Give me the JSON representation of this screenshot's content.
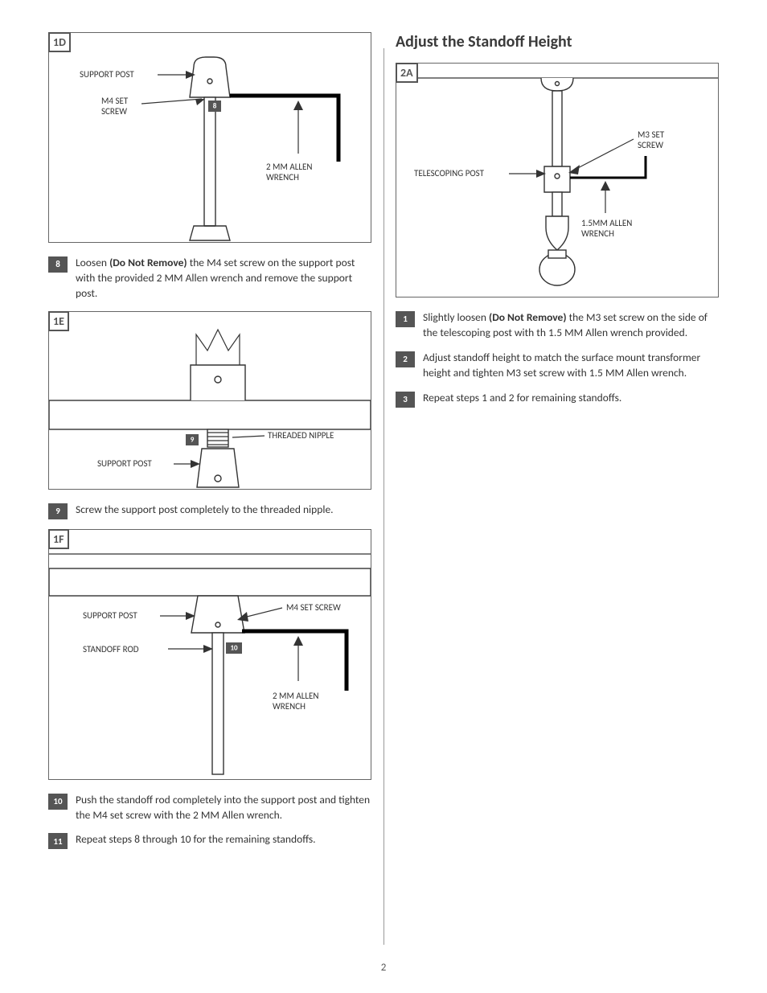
{
  "page_number": "2",
  "section2_title": "Adjust the Standoff Height",
  "figs": {
    "d": {
      "tag": "1D",
      "label_support_post": "SUPPORT POST",
      "label_m4": "M4 SET\nSCREW",
      "label_wrench": "2 MM ALLEN\nWRENCH",
      "callout": "8"
    },
    "e": {
      "tag": "1E",
      "label_nipple": "THREADED NIPPLE",
      "label_support_post": "SUPPORT POST",
      "callout": "9"
    },
    "f": {
      "tag": "1F",
      "label_support_post": "SUPPORT POST",
      "label_standoff": "STANDOFF ROD",
      "label_m4": "M4 SET SCREW",
      "label_wrench": "2 MM ALLEN\nWRENCH",
      "callout": "10"
    },
    "a2": {
      "tag": "2A",
      "label_post": "TELESCOPING POST",
      "label_m3": "M3 SET\nSCREW",
      "label_wrench": "1.5MM ALLEN\nWRENCH"
    }
  },
  "left_steps": [
    {
      "num": "8",
      "bold": "(Do Not Remove)",
      "pre": "Loosen ",
      "post": " the M4 set screw on the support post with the provided 2 MM Allen wrench and remove the support post."
    },
    {
      "num": "9",
      "bold": "",
      "pre": "",
      "post": "Screw the support post completely to the threaded nipple."
    },
    {
      "num": "10",
      "bold": "",
      "pre": "",
      "post": "Push the standoff rod completely into the support post and tighten the M4 set screw with the 2 MM Allen wrench."
    },
    {
      "num": "11",
      "bold": "",
      "pre": "",
      "post": "Repeat steps 8 through 10 for the remaining standoffs."
    }
  ],
  "right_steps": [
    {
      "num": "1",
      "bold": "(Do Not Remove)",
      "pre": "Slightly loosen ",
      "post": " the M3 set screw on the side of the telescoping post with th 1.5 MM Allen wrench provided."
    },
    {
      "num": "2",
      "bold": "",
      "pre": "",
      "post": "Adjust standoff height to match the surface mount transformer height and tighten M3 set screw with 1.5 MM Allen wrench."
    },
    {
      "num": "3",
      "bold": "",
      "pre": "",
      "post": "Repeat steps 1 and 2 for remaining standoffs."
    }
  ]
}
